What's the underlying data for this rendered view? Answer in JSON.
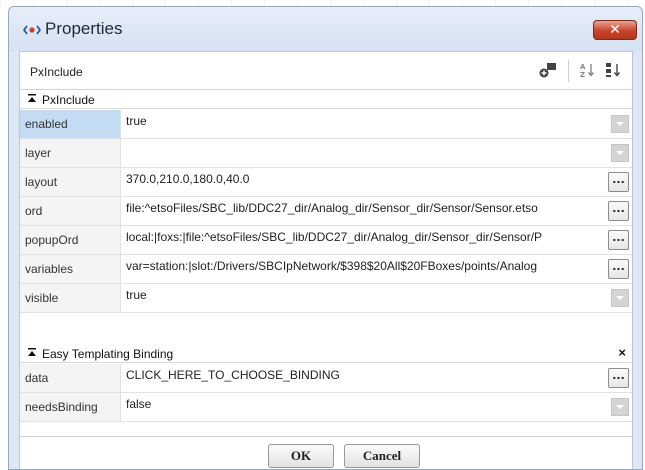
{
  "window": {
    "title": "Properties",
    "close_glyph": "✕",
    "icon": "component-icon"
  },
  "toolbar": {
    "title": "PxInclude",
    "buttons": [
      {
        "icon": "add-slot-icon"
      },
      {
        "icon": "sort-az-icon"
      },
      {
        "icon": "sort-order-icon"
      }
    ]
  },
  "sections": [
    {
      "label": "PxInclude",
      "collapse_glyph": "⯭",
      "rows": [
        {
          "name": "enabled",
          "value": "true",
          "control": "dropdown"
        },
        {
          "name": "layer",
          "value": "",
          "control": "dropdown"
        },
        {
          "name": "layout",
          "value": "370.0,210.0,180.0,40.0",
          "control": "ellipsis"
        },
        {
          "name": "ord",
          "value": "file:^etsoFiles/SBC_lib/DDC27_dir/Analog_dir/Sensor_dir/Sensor/Sensor.etso",
          "control": "ellipsis"
        },
        {
          "name": "popupOrd",
          "value": "local:|foxs:|file:^etsoFiles/SBC_lib/DDC27_dir/Analog_dir/Sensor_dir/Sensor/P",
          "control": "ellipsis"
        },
        {
          "name": "variables",
          "value": "var=station:|slot:/Drivers/SBCIpNetwork/$398$20All$20FBoxes/points/Analog",
          "control": "ellipsis"
        },
        {
          "name": "visible",
          "value": "true",
          "control": "dropdown"
        }
      ]
    },
    {
      "label": "Easy Templating Binding",
      "collapse_glyph": "⯭",
      "close_glyph": "×",
      "rows": [
        {
          "name": "data",
          "value": "CLICK_HERE_TO_CHOOSE_BINDING",
          "control": "ellipsis"
        },
        {
          "name": "needsBinding",
          "value": "false",
          "control": "dropdown"
        }
      ]
    }
  ],
  "ellipsis_label": "...",
  "buttons": {
    "ok": "OK",
    "cancel": "Cancel"
  },
  "colors": {
    "accent_selected": "#c4dcf3",
    "close_button": "#c7432b",
    "title_icon": "#1b4e9b"
  }
}
